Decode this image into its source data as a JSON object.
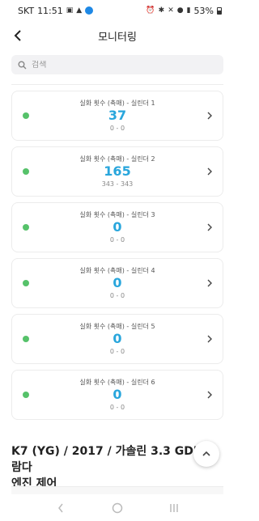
{
  "status_bar": {
    "carrier": "SKT",
    "time": "11:51",
    "battery": "53%"
  },
  "header": {
    "title": "모니터링"
  },
  "search": {
    "placeholder": "검색",
    "value": ""
  },
  "cards": [
    {
      "label": "실화 횟수 (촉매) - 실린더 1",
      "value": "37",
      "range": "0 - 0",
      "status_color": "#56c26a"
    },
    {
      "label": "실화 횟수 (촉매) - 실린더 2",
      "value": "165",
      "range": "343 - 343",
      "status_color": "#56c26a"
    },
    {
      "label": "실화 횟수 (촉매) - 실린더 3",
      "value": "0",
      "range": "0 - 0",
      "status_color": "#56c26a"
    },
    {
      "label": "실화 횟수 (촉매) - 실린더 4",
      "value": "0",
      "range": "0 - 0",
      "status_color": "#56c26a"
    },
    {
      "label": "실화 횟수 (촉매) - 실린더 5",
      "value": "0",
      "range": "0 - 0",
      "status_color": "#56c26a"
    },
    {
      "label": "실화 횟수 (촉매) - 실린더 6",
      "value": "0",
      "range": "0 - 0",
      "status_color": "#56c26a"
    }
  ],
  "vehicle": {
    "line1": "K7 (YG) / 2017 / 가솔린 3.3 GDI 람다",
    "line2": "엔진 제어"
  },
  "colors": {
    "value_accent": "#29a6dc",
    "status_ok": "#56c26a"
  }
}
